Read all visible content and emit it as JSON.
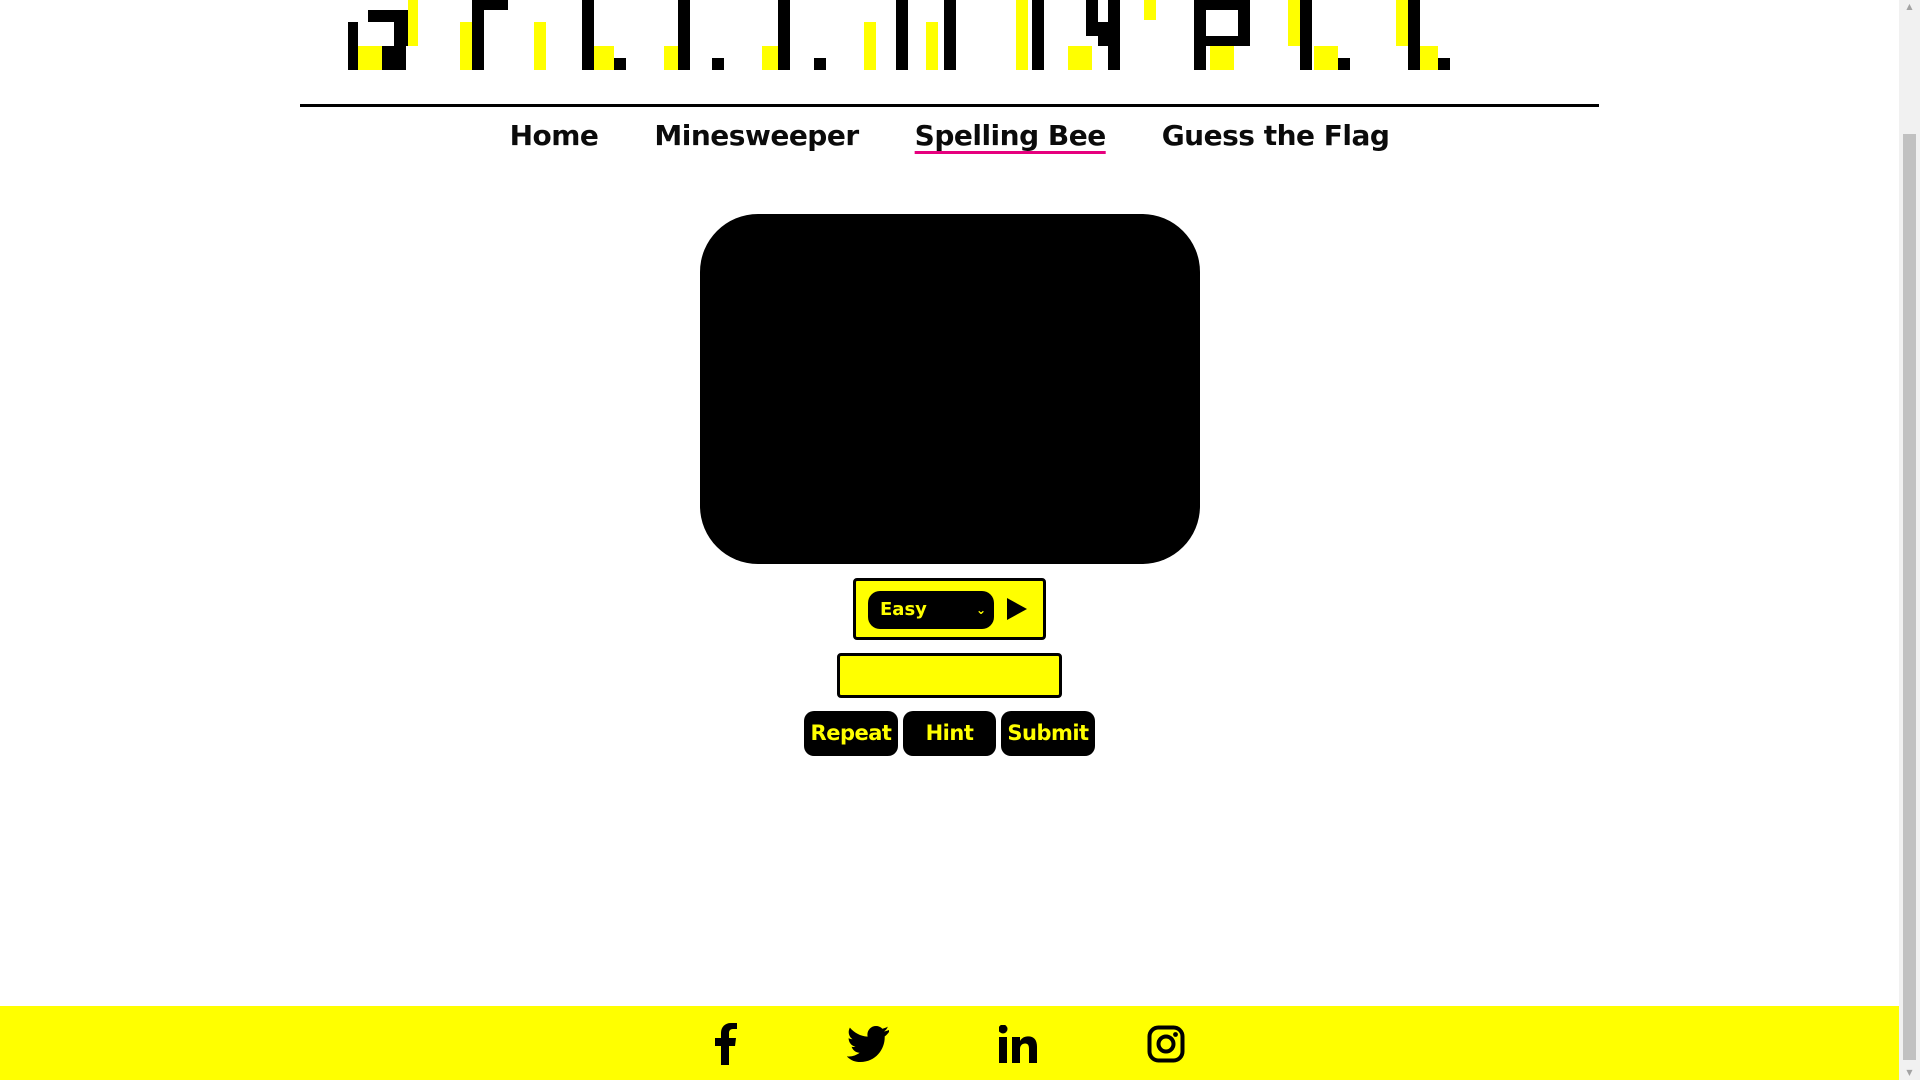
{
  "header": {
    "title_text": "SPELLING BEE"
  },
  "nav": {
    "items": [
      {
        "label": "Home",
        "active": false
      },
      {
        "label": "Minesweeper",
        "active": false
      },
      {
        "label": "Spelling Bee",
        "active": true
      },
      {
        "label": "Guess the Flag",
        "active": false
      }
    ]
  },
  "game": {
    "difficulty": {
      "selected": "Easy"
    },
    "answer": {
      "value": "",
      "placeholder": ""
    },
    "buttons": {
      "repeat": "Repeat",
      "hint": "Hint",
      "submit": "Submit"
    }
  },
  "footer": {
    "social_icons": [
      "facebook-icon",
      "twitter-icon",
      "linkedin-icon",
      "instagram-icon"
    ]
  },
  "colors": {
    "accent": "#ffff00",
    "dark": "#000000",
    "nav_underline": "#e6007e",
    "background": "#ffffff"
  }
}
